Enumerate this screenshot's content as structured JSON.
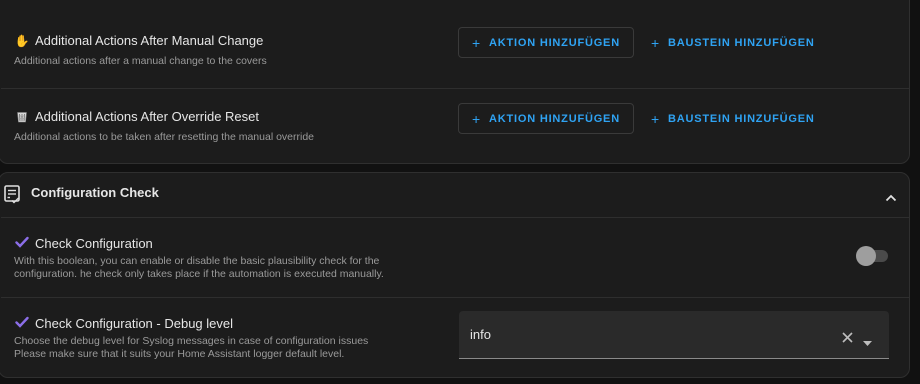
{
  "actions_card": {
    "manual_change": {
      "title": "Additional Actions After Manual Change",
      "description": "Additional actions after a manual change to the covers",
      "icon": "hand-icon",
      "add_action_label": "AKTION HINZUFÜGEN",
      "add_block_label": "BAUSTEIN HINZUFÜGEN"
    },
    "override_reset": {
      "title": "Additional Actions After Override Reset",
      "description": "Additional actions to be taken after resetting the manual override",
      "icon": "wastebasket-icon",
      "add_action_label": "AKTION HINZUFÜGEN",
      "add_block_label": "BAUSTEIN HINZUFÜGEN"
    }
  },
  "config_check_section": {
    "title": "Configuration Check",
    "icon": "checklist-icon",
    "expanded": true,
    "check_configuration": {
      "title": "Check Configuration",
      "description_line1": "With this boolean, you can enable or disable the basic plausibility check for the",
      "description_line2": "configuration. he check only takes place if the automation is executed manually.",
      "enabled": false
    },
    "debug_level": {
      "title": "Check Configuration - Debug level",
      "description_line1": "Choose the debug level for Syslog messages in case of configuration issues",
      "description_line2": "Please make sure that it suits your Home Assistant logger default level.",
      "selected_value": "info"
    }
  },
  "colors": {
    "accent": "#2fa3f3",
    "check_mark": "#8b6ee8",
    "background": "#111111",
    "card": "#1c1c1c"
  }
}
